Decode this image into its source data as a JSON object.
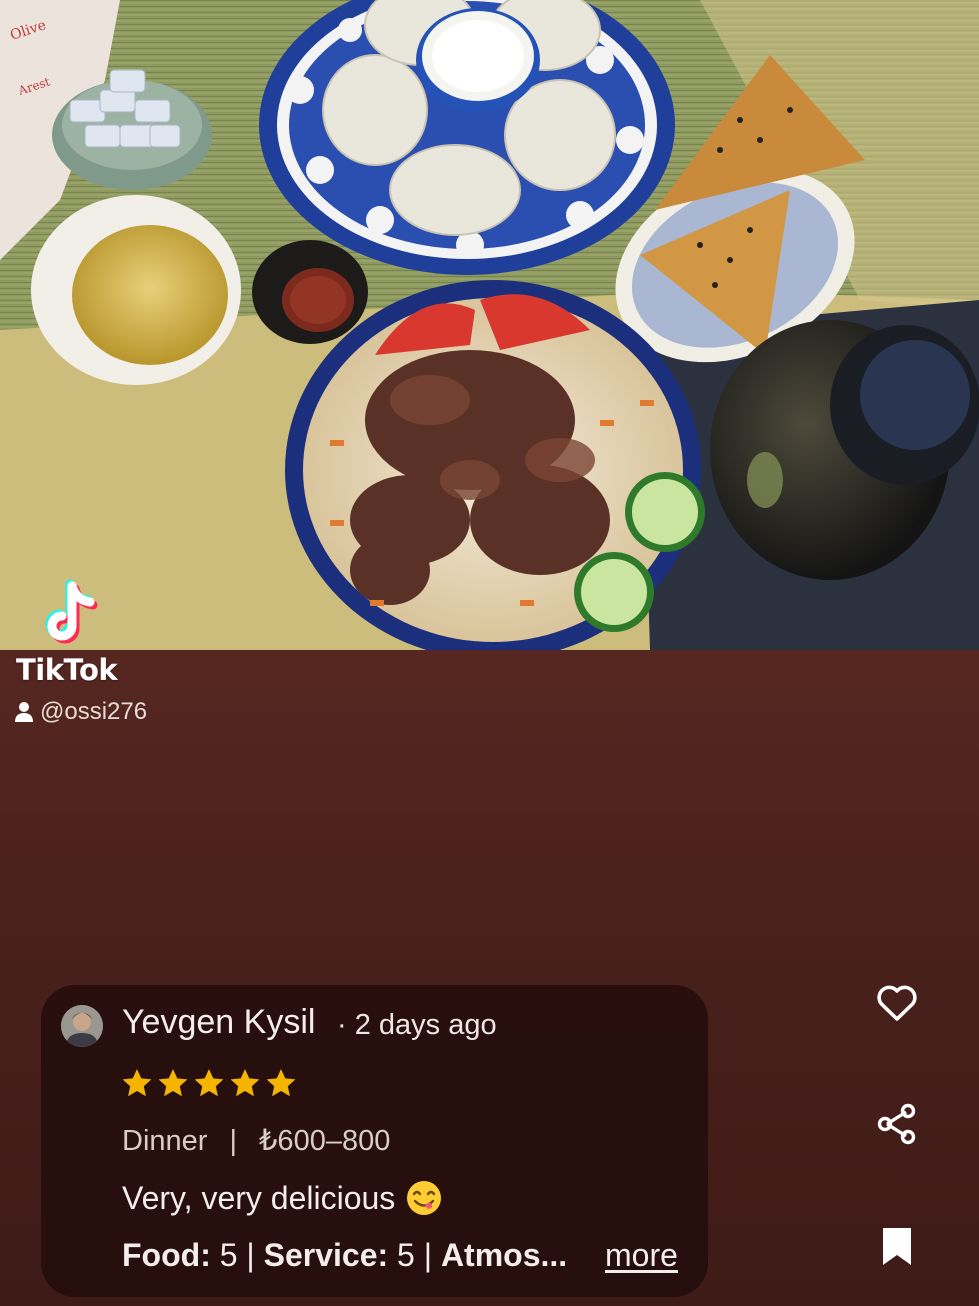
{
  "watermark": {
    "brand": "TikTok",
    "handle": "@ossi276",
    "icon": "tiktok-logo-icon"
  },
  "review": {
    "reviewer_name": "Yevgen Kysil",
    "time_ago": "· 2 days ago",
    "rating": 5,
    "rating_max": 5,
    "meal": "Dinner",
    "separator": "|",
    "price": "₺600–800",
    "text": "Very, very delicious",
    "emoji": "face-savoring-food",
    "ratings_food_label": "Food:",
    "ratings_food_value": "5",
    "ratings_service_label": "Service:",
    "ratings_service_value": "5",
    "ratings_atmosphere_label": "Atmos...",
    "ratings_divider": "|",
    "more_label": "more"
  },
  "actions": {
    "like_icon": "heart-icon",
    "share_icon": "share-icon",
    "save_icon": "bookmark-icon"
  },
  "colors": {
    "star": "#f5b400",
    "card_bg": "#210c0b",
    "page_bg": "#5f2b24"
  }
}
